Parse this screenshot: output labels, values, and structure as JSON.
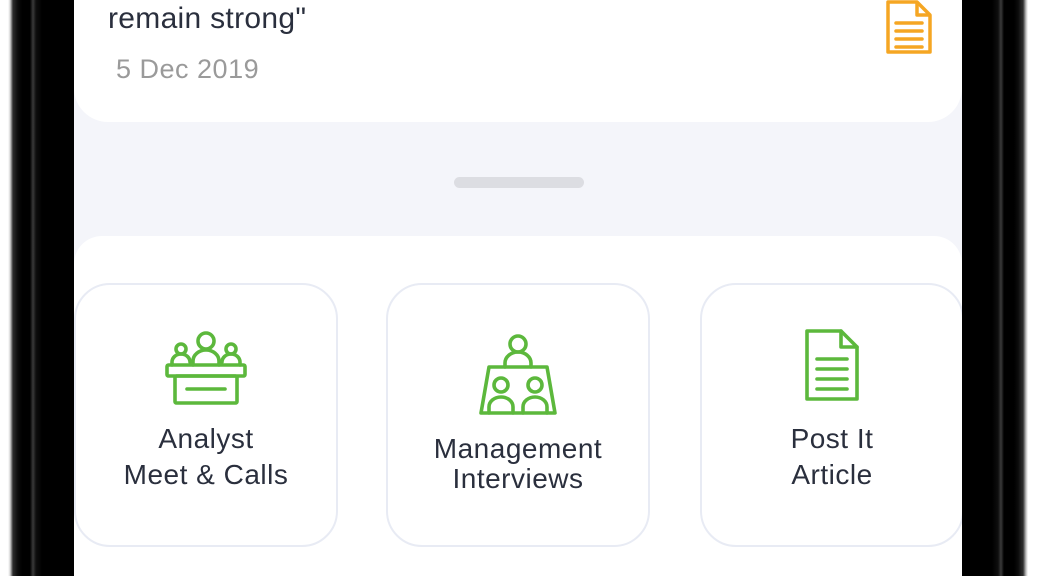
{
  "news": {
    "title": "remain strong\"",
    "date": "5 Dec 2019",
    "icon": "document-icon"
  },
  "actions": [
    {
      "line1": "Analyst",
      "line2": "Meet & Calls",
      "icon": "podium-speakers-icon"
    },
    {
      "line1": "Management",
      "line2": "Interviews",
      "icon": "meeting-group-icon"
    },
    {
      "line1": "Post It",
      "line2": "Article",
      "icon": "document-icon"
    }
  ],
  "colors": {
    "accent_green": "#5cb83c",
    "document_orange": "#f5a623",
    "text_dark": "#2a2f3d",
    "text_muted": "#9a9a9a"
  }
}
